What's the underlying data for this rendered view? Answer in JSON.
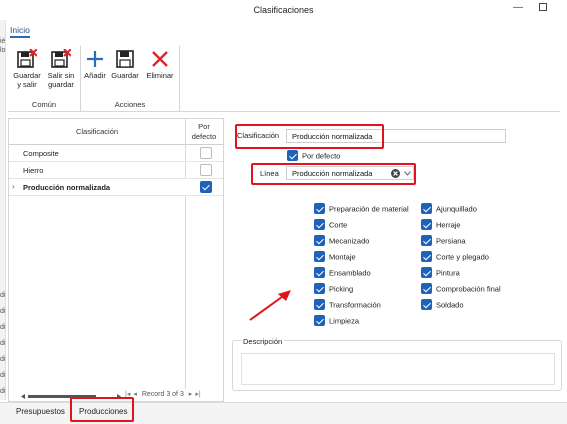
{
  "window": {
    "title": "Clasificaciones"
  },
  "edge_fragments": [
    "ié",
    "lo",
    "di",
    "di",
    "di",
    "di",
    "di",
    "di",
    "di"
  ],
  "ribbon": {
    "tab": "Inicio",
    "groups": [
      {
        "name": "Común",
        "buttons": [
          {
            "label1": "Guardar",
            "label2": "y salir",
            "icon": "save-close-icon"
          },
          {
            "label1": "Salir sin",
            "label2": "guardar",
            "icon": "exit-no-save-icon"
          }
        ]
      },
      {
        "name": "Acciones",
        "buttons": [
          {
            "label1": "Añadir",
            "label2": "",
            "icon": "add-icon"
          },
          {
            "label1": "Guardar",
            "label2": "",
            "icon": "save-icon"
          },
          {
            "label1": "Eliminar",
            "label2": "",
            "icon": "delete-icon"
          }
        ]
      }
    ]
  },
  "grid": {
    "col_name": "Clasificación",
    "col_default_1": "Por",
    "col_default_2": "defecto",
    "rows": [
      {
        "name": "Composite",
        "default": false
      },
      {
        "name": "Hierro",
        "default": false
      },
      {
        "name": "Producción normalizada",
        "default": true,
        "selected": true
      }
    ],
    "record": "Record 3 of 3"
  },
  "form": {
    "clasificacion_label": "Clasificación",
    "clasificacion_value": "Producción normalizada",
    "por_defecto_label": "Por defecto",
    "linea_label": "Línea",
    "linea_value": "Producción normalizada",
    "col1": [
      "Preparación de material",
      "Corte",
      "Mecanizado",
      "Montaje",
      "Ensamblado",
      "Picking",
      "Transformación",
      "Limpieza"
    ],
    "col2": [
      "Ajunquillado",
      "Herraje",
      "Persiana",
      "Corte y plegado",
      "Pintura",
      "Comprobación final",
      "Soldado"
    ],
    "descripcion_label": "Descripción"
  },
  "bottom_tabs": [
    "Presupuestos",
    "Producciones"
  ],
  "colors": {
    "accent": "#1f63b8",
    "highlight": "#e0141e"
  }
}
